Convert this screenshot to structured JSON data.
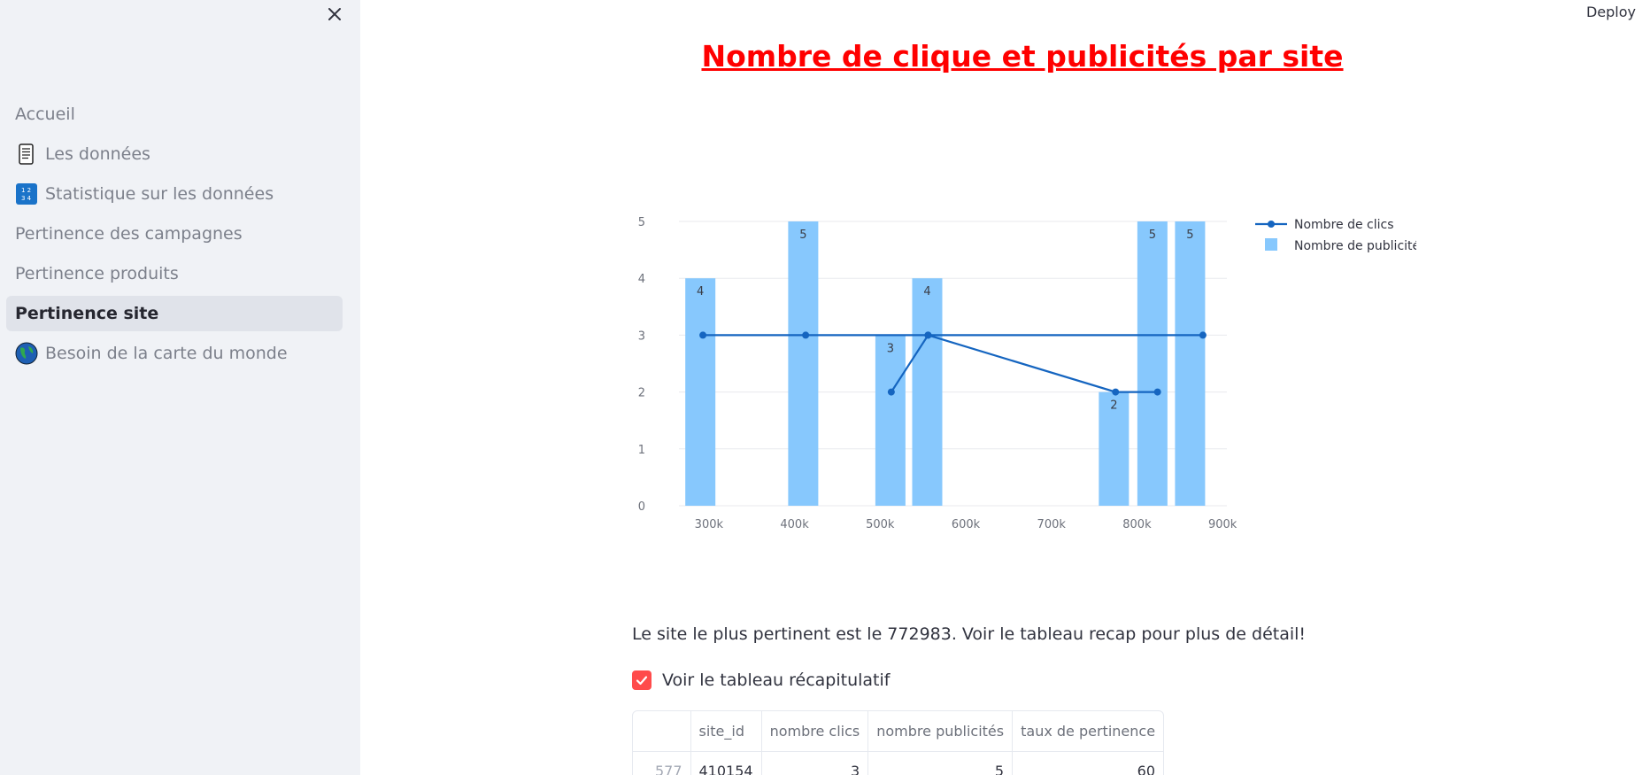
{
  "header": {
    "deploy_label": "Deploy"
  },
  "sidebar": {
    "items": [
      {
        "label": "Accueil",
        "icon": ""
      },
      {
        "label": "Les données",
        "icon": "scroll-icon"
      },
      {
        "label": "Statistique sur les données",
        "icon": "numbers-icon"
      },
      {
        "label": "Pertinence des campagnes",
        "icon": ""
      },
      {
        "label": "Pertinence produits",
        "icon": ""
      },
      {
        "label": "Pertinence site",
        "icon": "",
        "active": true
      },
      {
        "label": "Besoin de la carte du monde",
        "icon": "globe-icon"
      }
    ]
  },
  "main": {
    "title": "Nombre de clique et publicités par site",
    "insight": "Le site le plus pertinent est le 772983. Voir le tableau recap pour plus de détail!",
    "checkbox_label": "Voir le tableau récapitulatif",
    "checkbox_checked": true,
    "table": {
      "columns": [
        "",
        "site_id",
        "nombre clics",
        "nombre publicités",
        "taux de pertinence"
      ],
      "rows": [
        [
          "577",
          "410154",
          "3",
          "5",
          "60"
        ]
      ]
    }
  },
  "chart_data": {
    "type": "bar",
    "title": "",
    "xlabel": "",
    "ylabel": "",
    "x_ticks": [
      "300k",
      "400k",
      "500k",
      "600k",
      "700k",
      "800k",
      "900k"
    ],
    "x_tick_values": [
      300000,
      400000,
      500000,
      600000,
      700000,
      800000,
      900000
    ],
    "y_ticks": [
      0,
      1,
      2,
      3,
      4,
      5
    ],
    "xlim": [
      265000,
      905000
    ],
    "ylim": [
      0,
      5
    ],
    "grid": true,
    "legend": "top-right",
    "series": [
      {
        "name": "Nombre de publicités",
        "type": "bar",
        "color": "#87c8fd",
        "x": [
          290000,
          410154,
          512000,
          555000,
          773000,
          818000,
          862000
        ],
        "values": [
          4,
          5,
          3,
          4,
          2,
          5,
          5
        ],
        "labels": [
          "4",
          "5",
          "3",
          "4",
          "2",
          "5",
          "5"
        ]
      },
      {
        "name": "Nombre de clics",
        "type": "line",
        "color": "#1565c0",
        "x": [
          513000,
          556000,
          877000,
          293000,
          413000,
          556000,
          775000,
          824000
        ],
        "values": [
          2,
          3,
          3,
          3,
          3,
          3,
          2,
          2
        ]
      }
    ]
  }
}
